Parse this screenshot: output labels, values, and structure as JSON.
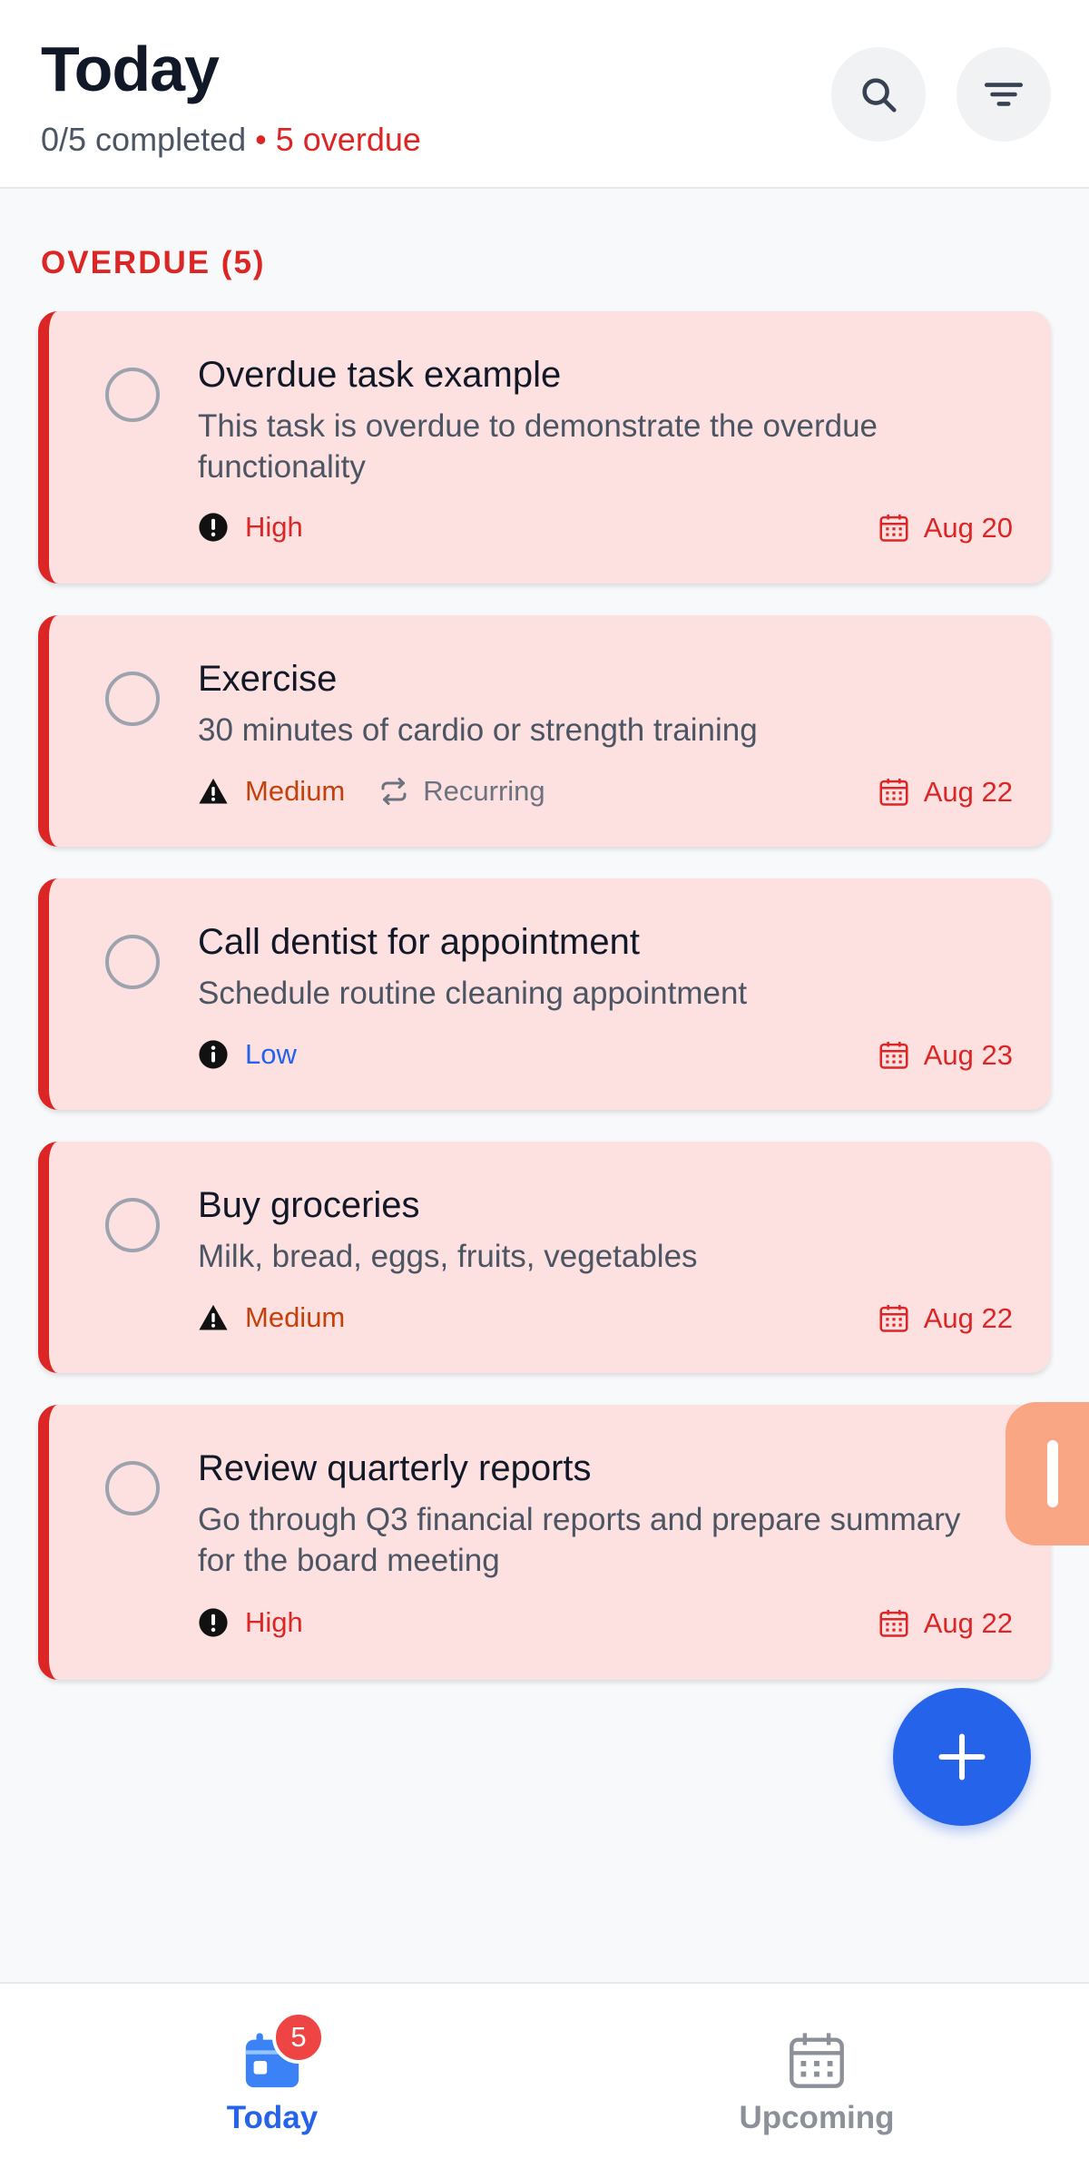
{
  "header": {
    "title": "Today",
    "completed": "0/5 completed",
    "separator": "•",
    "overdue": "5 overdue"
  },
  "section": {
    "label": "OVERDUE (5)"
  },
  "tasks": [
    {
      "title": "Overdue task example",
      "description": "This task is overdue to demonstrate the overdue functionality",
      "priority": "High",
      "priority_icon": "exclamation-circle-icon",
      "recurring": "",
      "due": "Aug 20"
    },
    {
      "title": "Exercise",
      "description": "30 minutes of cardio or strength training",
      "priority": "Medium",
      "priority_icon": "warning-triangle-icon",
      "recurring": "Recurring",
      "due": "Aug 22"
    },
    {
      "title": "Call dentist for appointment",
      "description": "Schedule routine cleaning appointment",
      "priority": "Low",
      "priority_icon": "info-circle-icon",
      "recurring": "",
      "due": "Aug 23"
    },
    {
      "title": "Buy groceries",
      "description": "Milk, bread, eggs, fruits, vegetables",
      "priority": "Medium",
      "priority_icon": "warning-triangle-icon",
      "recurring": "",
      "due": "Aug 22"
    },
    {
      "title": "Review quarterly reports",
      "description": "Go through Q3 financial reports and prepare summary for the board meeting",
      "priority": "High",
      "priority_icon": "exclamation-circle-icon",
      "recurring": "",
      "due": "Aug 22"
    }
  ],
  "nav": {
    "today_label": "Today",
    "today_badge": "5",
    "upcoming_label": "Upcoming"
  },
  "colors": {
    "accent": "#2563eb",
    "overdue": "#dc2626",
    "card_bg": "#fde0e0",
    "medium": "#c2410c",
    "low": "#2563eb"
  }
}
